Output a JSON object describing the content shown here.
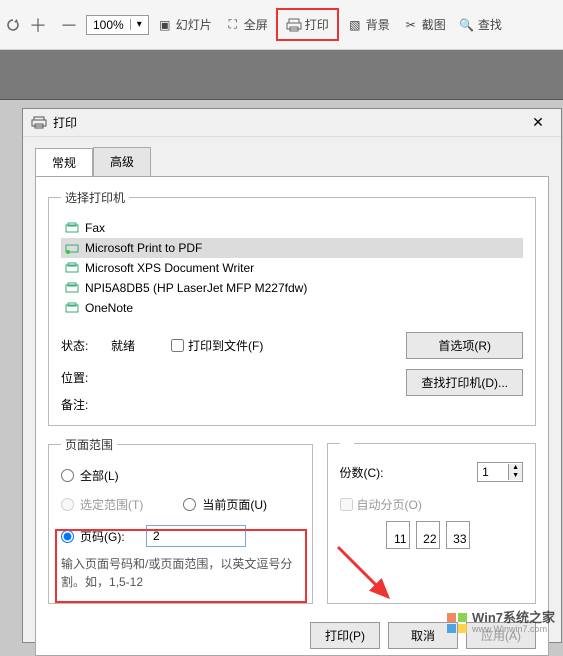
{
  "toolbar": {
    "zoom": "100%",
    "slides": "幻灯片",
    "fullscreen": "全屏",
    "print": "打印",
    "background": "背景",
    "screenshot": "截图",
    "find": "查找"
  },
  "dialog": {
    "title": "打印",
    "tab_general": "常规",
    "tab_advanced": "高级",
    "printer_group": "选择打印机",
    "printers": [
      {
        "name": "Fax"
      },
      {
        "name": "Microsoft Print to PDF"
      },
      {
        "name": "Microsoft XPS Document Writer"
      },
      {
        "name": "NPI5A8DB5 (HP LaserJet MFP M227fdw)"
      },
      {
        "name": "OneNote"
      }
    ],
    "status_label": "状态:",
    "status_value": "就绪",
    "location_label": "位置:",
    "notes_label": "备注:",
    "print_to_file": "打印到文件(F)",
    "preferences_btn": "首选项(R)",
    "find_printer_btn": "查找打印机(D)...",
    "range_group": "页面范围",
    "range_all": "全部(L)",
    "range_selection": "选定范围(T)",
    "range_current": "当前页面(U)",
    "range_pages": "页码(G):",
    "range_value": "2",
    "range_hint": "输入页面号码和/或页面范围，以英文逗号分割。如，1,5-12",
    "copies_label": "份数(C):",
    "copies_value": "1",
    "collate_label": "自动分页(O)",
    "c1": "11",
    "c2": "22",
    "c3": "33",
    "print_btn": "打印(P)",
    "cancel_btn": "取消",
    "apply_btn": "应用(A)"
  },
  "watermark": {
    "line1": "Win7系统之家",
    "line2": "www.Winwin7.com"
  }
}
